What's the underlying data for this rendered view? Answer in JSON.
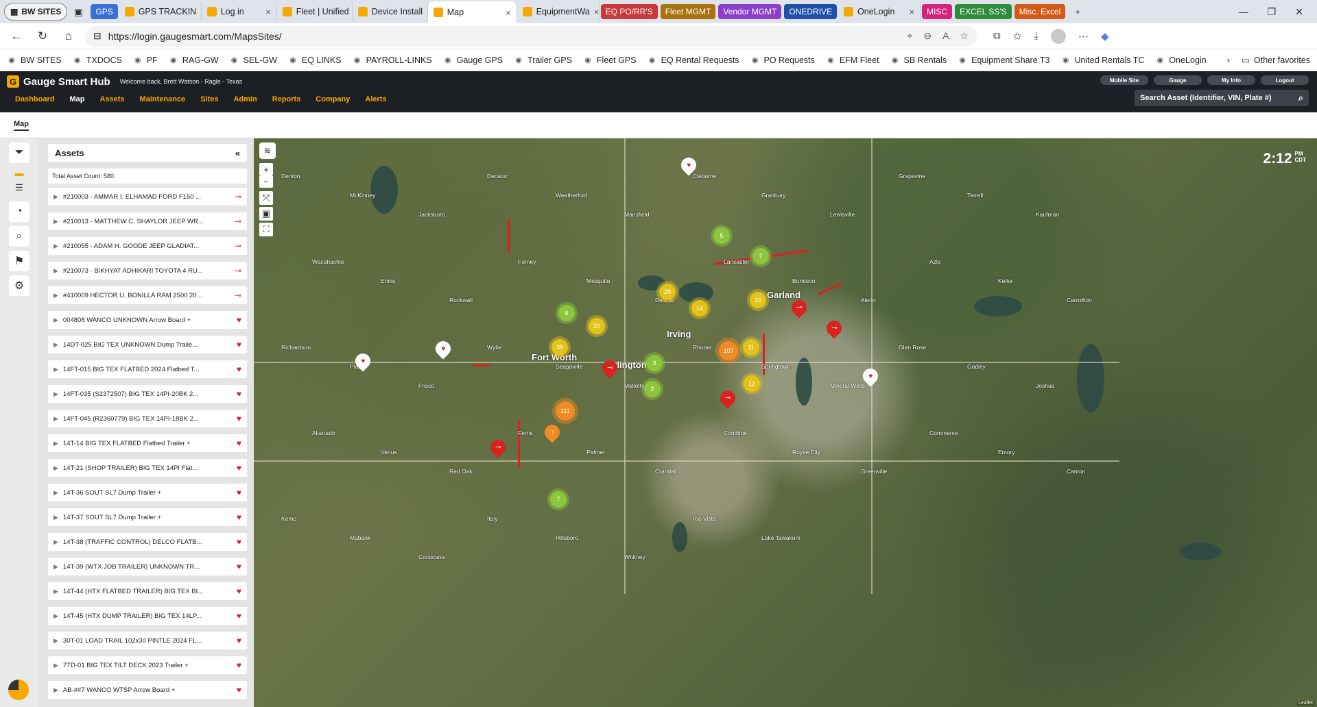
{
  "browser": {
    "profile": "BW SITES",
    "tabs": [
      {
        "label": "GPS",
        "kind": "group",
        "color": "#3b6fd8"
      },
      {
        "label": "GPS TRACKIN",
        "kind": "tab"
      },
      {
        "label": "Log in",
        "kind": "tab"
      },
      {
        "label": "Fleet | Unified",
        "kind": "tab"
      },
      {
        "label": "Device Install",
        "kind": "tab"
      },
      {
        "label": "Map",
        "kind": "active"
      },
      {
        "label": "EquipmentWa",
        "kind": "tab"
      },
      {
        "label": "EQ PO/RR'S",
        "kind": "group",
        "color": "#c8393b"
      },
      {
        "label": "Fleet MGMT",
        "kind": "group",
        "color": "#a9720f"
      },
      {
        "label": "Vendor MGMT",
        "kind": "group",
        "color": "#8b3fc9"
      },
      {
        "label": "ONEDRIVE",
        "kind": "group",
        "color": "#1f4fa8"
      },
      {
        "label": "OneLogin",
        "kind": "tab"
      },
      {
        "label": "MISC",
        "kind": "group",
        "color": "#d3237d"
      },
      {
        "label": "EXCEL SS'S",
        "kind": "group",
        "color": "#2f8a3a"
      },
      {
        "label": "Misc. Excel",
        "kind": "group",
        "color": "#d45a1a"
      }
    ],
    "url": "https://login.gaugesmart.com/MapsSites/",
    "favorites": [
      "BW SITES",
      "TXDOCS",
      "PF",
      "RAG-GW",
      "SEL-GW",
      "EQ LINKS",
      "PAYROLL-LINKS",
      "Gauge GPS",
      "Trailer GPS",
      "Fleet GPS",
      "EQ Rental Requests",
      "PO Requests",
      "EFM Fleet",
      "SB Rentals",
      "Equipment Share T3",
      "United Rentals TC",
      "OneLogin"
    ],
    "other_favorites": "Other favorites"
  },
  "app": {
    "brand": "Gauge Smart Hub",
    "welcome": "Welcome back, Brett Watson - Ragle - Texas",
    "header_buttons": [
      "Mobile Site",
      "Gauge",
      "My Info",
      "Logout"
    ],
    "nav": [
      "Dashboard",
      "Map",
      "Assets",
      "Maintenance",
      "Sites",
      "Admin",
      "Reports",
      "Company",
      "Alerts"
    ],
    "search_placeholder": "Search Asset (Identifier, VIN, Plate #)",
    "breadcrumb": "Map"
  },
  "panel": {
    "title": "Assets",
    "total": "Total Asset Count: 580",
    "assets": [
      {
        "label": "#210003 - AMMAR I. ELHAMAD FORD F150 ...",
        "status": "key"
      },
      {
        "label": "#210013 - MATTHEW C. SHAYLOR JEEP WR...",
        "status": "key"
      },
      {
        "label": "#210055 - ADAM H. GOODE JEEP GLADIAT...",
        "status": "key"
      },
      {
        "label": "#210073 - BIKHYAT ADHIKARI TOYOTA 4 RU...",
        "status": "key"
      },
      {
        "label": "#410009 HECTOR U. BONILLA RAM 2500 20...",
        "status": "key"
      },
      {
        "label": "004808 WANCO UNKNOWN Arrow Board +",
        "status": "heart"
      },
      {
        "label": "14DT-025 BIG TEX UNKNOWN Dump Traile...",
        "status": "heart"
      },
      {
        "label": "14FT-015 BIG TEX FLATBED 2024 Flatbed T...",
        "status": "heart"
      },
      {
        "label": "14FT-035 (S2372507) BIG TEX 14PI-20BK 2...",
        "status": "heart"
      },
      {
        "label": "14FT-045 (R2360779) BIG TEX 14PI-18BK 2...",
        "status": "heart"
      },
      {
        "label": "14T-14 BIG TEX FLATBED Flatbed Trailer +",
        "status": "heart"
      },
      {
        "label": "14T-21 (SHOP TRAILER) BIG TEX 14PI Flat...",
        "status": "heart"
      },
      {
        "label": "14T-36 SOUT SL7 Dump Trailer +",
        "status": "heart"
      },
      {
        "label": "14T-37 SOUT SL7 Dump Trailer +",
        "status": "heart"
      },
      {
        "label": "14T-38 (TRAFFIC CONTROL) DELCO FLATB...",
        "status": "heart"
      },
      {
        "label": "14T-39 (WTX JOB TRAILER) UNKNOWN TR...",
        "status": "heart"
      },
      {
        "label": "14T-44 (HTX FLATBED TRAILER) BIG TEX BI...",
        "status": "heart"
      },
      {
        "label": "14T-45 (HTX DUMP TRAILER) BIG TEX 14LP...",
        "status": "heart"
      },
      {
        "label": "30T-01 LOAD TRAIL 102x30 PINTLE 2024 FL...",
        "status": "heart"
      },
      {
        "label": "7TD-01 BIG TEX TILT DECK 2023 Trailer +",
        "status": "heart"
      },
      {
        "label": "AB-##7 WANCO WTSP Arrow Board +",
        "status": "heart"
      }
    ]
  },
  "map": {
    "clock": "2:12",
    "clock_suffix_1": "PM",
    "clock_suffix_2": "CDT",
    "clusters": [
      {
        "count": "5",
        "color": "green"
      },
      {
        "count": "7",
        "color": "green"
      },
      {
        "count": "29",
        "color": "yellow"
      },
      {
        "count": "14",
        "color": "yellow"
      },
      {
        "count": "10",
        "color": "yellow"
      },
      {
        "count": "6",
        "color": "green"
      },
      {
        "count": "20",
        "color": "yellow"
      },
      {
        "count": "38",
        "color": "yellow"
      },
      {
        "count": "107",
        "color": "orange"
      },
      {
        "count": "11",
        "color": "yellow"
      },
      {
        "count": "3",
        "color": "green"
      },
      {
        "count": "2",
        "color": "green"
      },
      {
        "count": "12",
        "color": "yellow"
      },
      {
        "count": "111",
        "color": "orange"
      },
      {
        "count": "7",
        "color": "green"
      }
    ],
    "places_major": [
      "Fort Worth",
      "Arlington",
      "Irving",
      "Garland"
    ],
    "places": [
      "Denton",
      "McKinney",
      "Jacksboro",
      "Decatur",
      "Weatherford",
      "Mansfield",
      "Cleburne",
      "Granbury",
      "Lewisville",
      "Grapevine",
      "Terrell",
      "Kaufman",
      "Waxahachie",
      "Ennis",
      "Rockwall",
      "Forney",
      "Mesquite",
      "DeSoto",
      "Lancaster",
      "Burleson",
      "Aledo",
      "Azle",
      "Keller",
      "Carrollton",
      "Richardson",
      "Plano",
      "Frisco",
      "Wylie",
      "Seagoville",
      "Midlothian",
      "Rhome",
      "Springtown",
      "Mineral Wells",
      "Glen Rose",
      "Godley",
      "Joshua",
      "Alvarado",
      "Venus",
      "Red Oak",
      "Ferris",
      "Palmer",
      "Crandall",
      "Combine",
      "Royse City",
      "Greenville",
      "Commerce",
      "Emory",
      "Canton",
      "Kemp",
      "Mabank",
      "Corsicana",
      "Italy",
      "Hillsboro",
      "Whitney",
      "Rio Vista",
      "Lake Tawakoni"
    ],
    "attribution": "Leaflet"
  }
}
